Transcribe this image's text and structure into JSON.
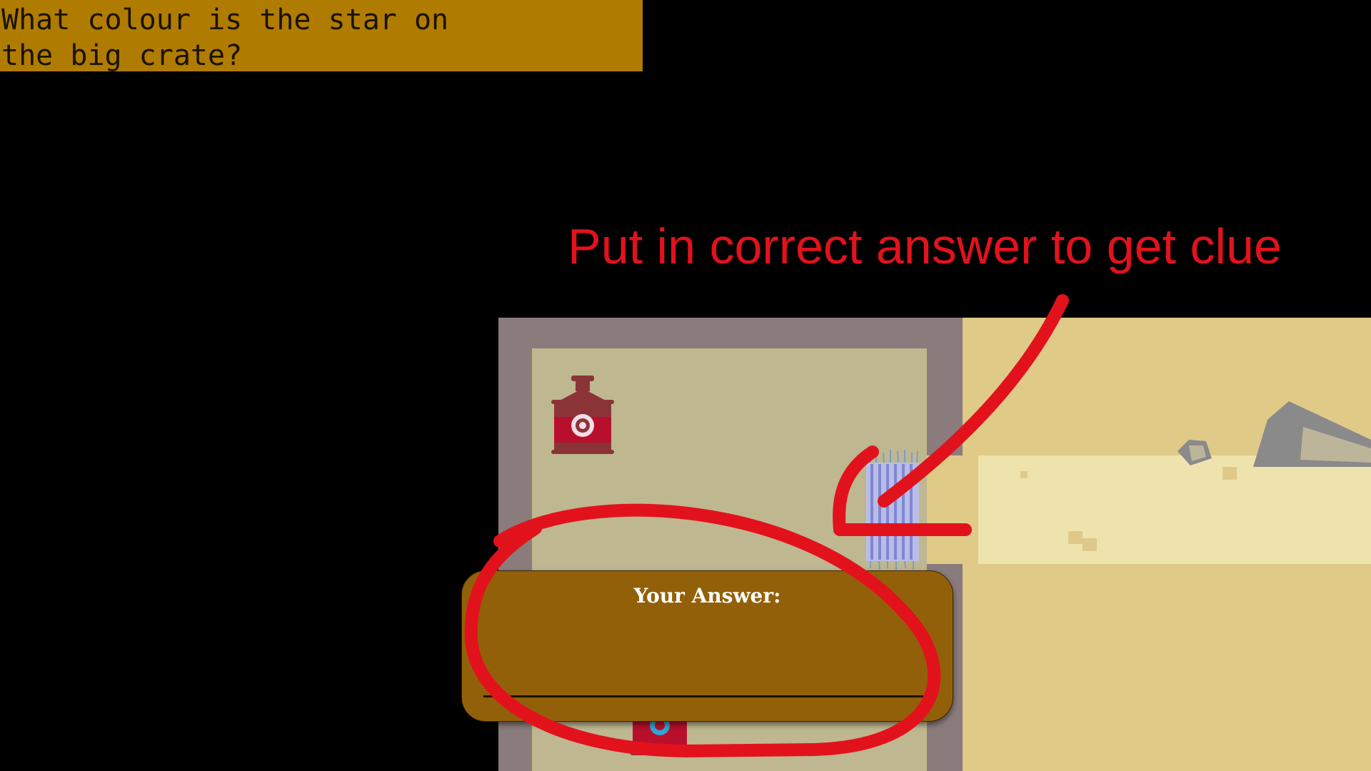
{
  "question": {
    "text": "What colour is the star on\nthe big crate?"
  },
  "annotation": {
    "text": "Put in correct answer to get clue"
  },
  "answer_panel": {
    "label": "Your Answer:",
    "input_value": "",
    "input_placeholder": ""
  },
  "colors": {
    "question_bg": "#b07c00",
    "annotation_red": "#e2121c",
    "panel_bg": "#93600a",
    "wall": "#8a7c7c",
    "floor": "#bfb790",
    "sand": "#dfca88",
    "path": "#efe3ad"
  },
  "icons": {
    "lantern": "red-lantern-icon",
    "rack": "blue-bottle-rack-icon",
    "rocks": "grey-rock-icon",
    "annotation_arrow": "red-arrow-icon",
    "annotation_circle": "red-circle-icon"
  }
}
